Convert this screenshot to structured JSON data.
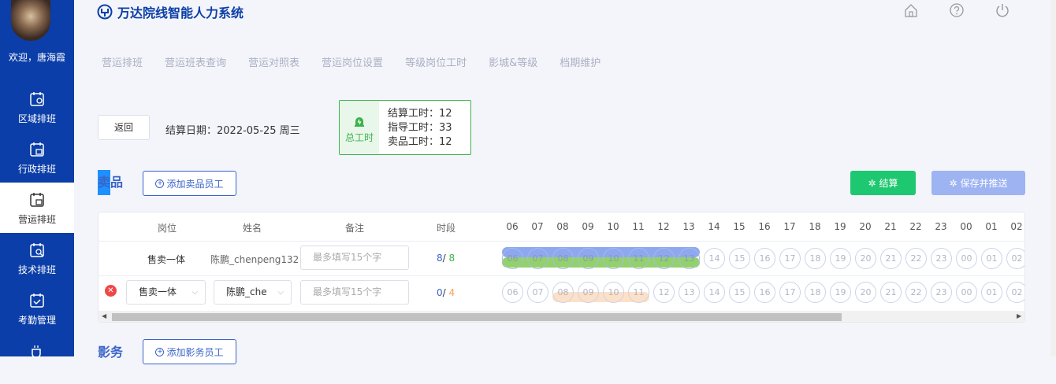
{
  "app": {
    "title": "万达院线智能人力系统"
  },
  "user": {
    "welcome": "欢迎，唐海霞"
  },
  "sidebar": {
    "items": [
      {
        "label": "区域排班",
        "icon": "calendar-location-icon",
        "active": false
      },
      {
        "label": "行政排班",
        "icon": "calendar-admin-icon",
        "active": false
      },
      {
        "label": "营运排班",
        "icon": "calendar-ops-icon",
        "active": true
      },
      {
        "label": "技术排班",
        "icon": "calendar-tech-icon",
        "active": false
      },
      {
        "label": "考勤管理",
        "icon": "calendar-check-icon",
        "active": false
      }
    ]
  },
  "topbar": {
    "icons": [
      "home-icon",
      "help-icon",
      "power-icon"
    ]
  },
  "topnav": {
    "items": [
      "营运排班",
      "营运班表查询",
      "营运对照表",
      "营运岗位设置",
      "等级岗位工时",
      "影城&等级",
      "档期维护"
    ]
  },
  "toolbar": {
    "back_label": "返回",
    "settle_date": "结算日期：2022-05-25 周三"
  },
  "hours_summary": {
    "label": "总工时",
    "lines": [
      "结算工时：12",
      "指导工时：33",
      "卖品工时：12"
    ]
  },
  "colors": {
    "accent": "#0b3ea8",
    "success": "#1ec870",
    "disabled": "#9db3f2",
    "assigned": "#8ea8f0",
    "actual": "#93d26a",
    "pending": "#fde0c8"
  },
  "sell_section": {
    "title": "卖品",
    "add_label": "添加卖品员工",
    "settle_label": "结算",
    "save_label": "保存并推送",
    "table": {
      "headers": {
        "position": "岗位",
        "name": "姓名",
        "note": "备注",
        "period": "时段"
      },
      "hours": [
        "06",
        "07",
        "08",
        "09",
        "10",
        "11",
        "12",
        "13",
        "14",
        "15",
        "16",
        "17",
        "18",
        "19",
        "20",
        "21",
        "22",
        "23",
        "00",
        "01",
        "02"
      ],
      "rows": [
        {
          "position": "售卖一体",
          "name": "陈鹏_chenpeng132",
          "note_placeholder": "最多填写15个字",
          "period_a": "8",
          "period_sep": "/ ",
          "period_b": "8"
        },
        {
          "position": "售卖一体",
          "name": "陈鹏_che",
          "note_placeholder": "最多填写15个字",
          "period_a": "0",
          "period_sep": "/ ",
          "period_b": "4"
        }
      ]
    }
  },
  "film_section": {
    "title": "影务",
    "add_label": "添加影务员工"
  }
}
